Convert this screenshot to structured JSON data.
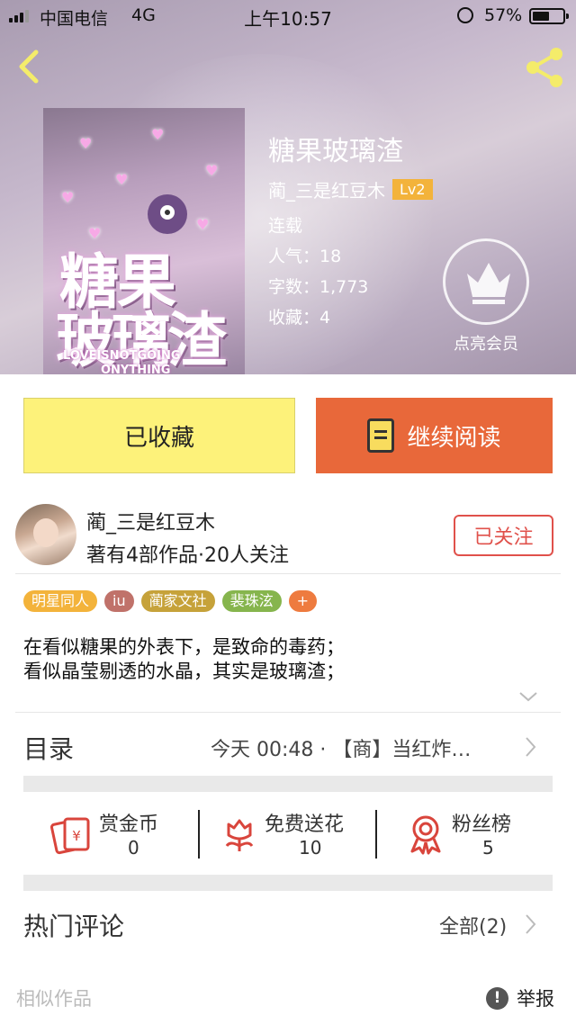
{
  "status_bar": {
    "carrier": "中国电信",
    "network": "4G",
    "time": "上午10:57",
    "battery_pct": "57%",
    "battery_level": 0.57
  },
  "book": {
    "title": "糖果玻璃渣",
    "author": "蔺_三是红豆木",
    "level": "Lv2",
    "status": "连载",
    "popularity": "人气：18",
    "word_count": "字数：1,773",
    "favorites": "收藏：4",
    "cover_text": {
      "line1": "糖果",
      "line2": "玻璃渣",
      "en1": "LOVEISNOTGOING",
      "en2": "ONYTHING"
    }
  },
  "vip": {
    "label": "点亮会员",
    "icon": "crown-icon"
  },
  "actions": {
    "collect_label": "已收藏",
    "read_label": "继续阅读"
  },
  "author_card": {
    "name": "蔺_三是红豆木",
    "stats": "著有4部作品·20人关注",
    "follow_label": "已关注"
  },
  "tags": [
    {
      "label": "明星同人",
      "color": "#f3b33b"
    },
    {
      "label": "iu",
      "color": "#c0726a"
    },
    {
      "label": "蔺家文社",
      "color": "#c6a23a"
    },
    {
      "label": "裴珠泫",
      "color": "#86b54d"
    },
    {
      "label": "+",
      "color": "#ee7b3f"
    }
  ],
  "description": {
    "line1": "在看似糖果的外表下，是致命的毒药；",
    "line2": "看似晶莹剔透的水晶，其实是玻璃渣；"
  },
  "toc": {
    "label": "目录",
    "latest": "今天 00:48 · 【商】当红炸…"
  },
  "stats": [
    {
      "label": "赏金币",
      "value": "0",
      "icon": "red-envelope-icon"
    },
    {
      "label": "免费送花",
      "value": "10",
      "icon": "flower-icon"
    },
    {
      "label": "粉丝榜",
      "value": "5",
      "icon": "ribbon-badge-icon"
    }
  ],
  "comments": {
    "label": "热门评论",
    "all_label": "全部(2)"
  },
  "footer": {
    "similar_label": "相似作品",
    "report_label": "举报"
  },
  "colors": {
    "accent_orange": "#e8683a",
    "collect_yellow": "#fdf27a",
    "follow_red": "#e0514b",
    "icon_red": "#d9453c"
  }
}
